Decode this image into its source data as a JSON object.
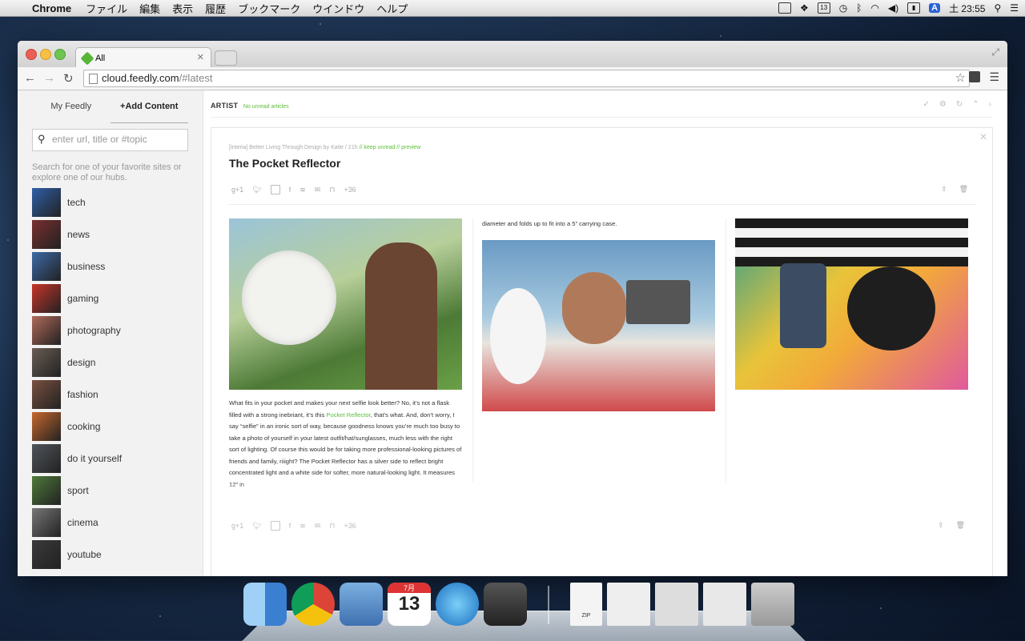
{
  "menubar": {
    "app_name": "Chrome",
    "items": [
      "ファイル",
      "編集",
      "表示",
      "履歴",
      "ブックマーク",
      "ウインドウ",
      "ヘルプ"
    ],
    "calendar_day": "13",
    "input_badge": "A",
    "clock": "土 23:55"
  },
  "browser": {
    "tab_title": "All",
    "url_host": "cloud.feedly.com",
    "url_path": "/#latest"
  },
  "sidebar": {
    "tab_my_feedly": "My Feedly",
    "tab_add_content": "+Add Content",
    "search_placeholder": "enter url, title or #topic",
    "hint": "Search for one of your favorite sites or explore one of our hubs.",
    "hubs": [
      {
        "label": "tech",
        "color": "#2f5fa8"
      },
      {
        "label": "news",
        "color": "#7a2e2e"
      },
      {
        "label": "business",
        "color": "#3c6aa8"
      },
      {
        "label": "gaming",
        "color": "#c8342a"
      },
      {
        "label": "photography",
        "color": "#b06a5a"
      },
      {
        "label": "design",
        "color": "#6a5d55"
      },
      {
        "label": "fashion",
        "color": "#7a5040"
      },
      {
        "label": "cooking",
        "color": "#c6682c"
      },
      {
        "label": "do it yourself",
        "color": "#50555a"
      },
      {
        "label": "sport",
        "color": "#4e7a3a"
      },
      {
        "label": "cinema",
        "color": "#777777"
      },
      {
        "label": "youtube",
        "color": "#3a3a3a"
      }
    ]
  },
  "main": {
    "section_title": "ARTIST",
    "section_status": "No unread articles",
    "article": {
      "meta_source": "[Interia] Better Living Through Design by Katie",
      "meta_sep1": "/",
      "meta_age": "21h",
      "meta_sep2": "//",
      "meta_keep_unread": "keep unread",
      "meta_sep3": "//",
      "meta_preview": "preview",
      "title": "The Pocket Reflector",
      "share_count": "+36",
      "google_plus": "g+1",
      "para_before_link": "What fits in your pocket and makes your next selfie look better? No, it’s not a flask filled with a strong inebriant, it’s this ",
      "link_text": "Pocket Reflector",
      "para_after_link": ", that’s what. And, don’t worry, I say “selfie” in an ironic sort of way, because goodness knows you’re much too busy to take a photo of yourself in your latest outfit/hat/sunglasses, much less with the right sort of lighting. Of course this would be for taking more professional-looking pictures of friends and family, riiight? The Pocket Reflector has a silver side to reflect bright concentrated light and a white side for softer, more natural-looking light. It measures 12” in",
      "col2_text": "diameter and folds up to fit into a 5” carrying case."
    }
  },
  "dock": {
    "zip_label": "ZIP",
    "calendar_month": "7月",
    "calendar_day": "13"
  }
}
